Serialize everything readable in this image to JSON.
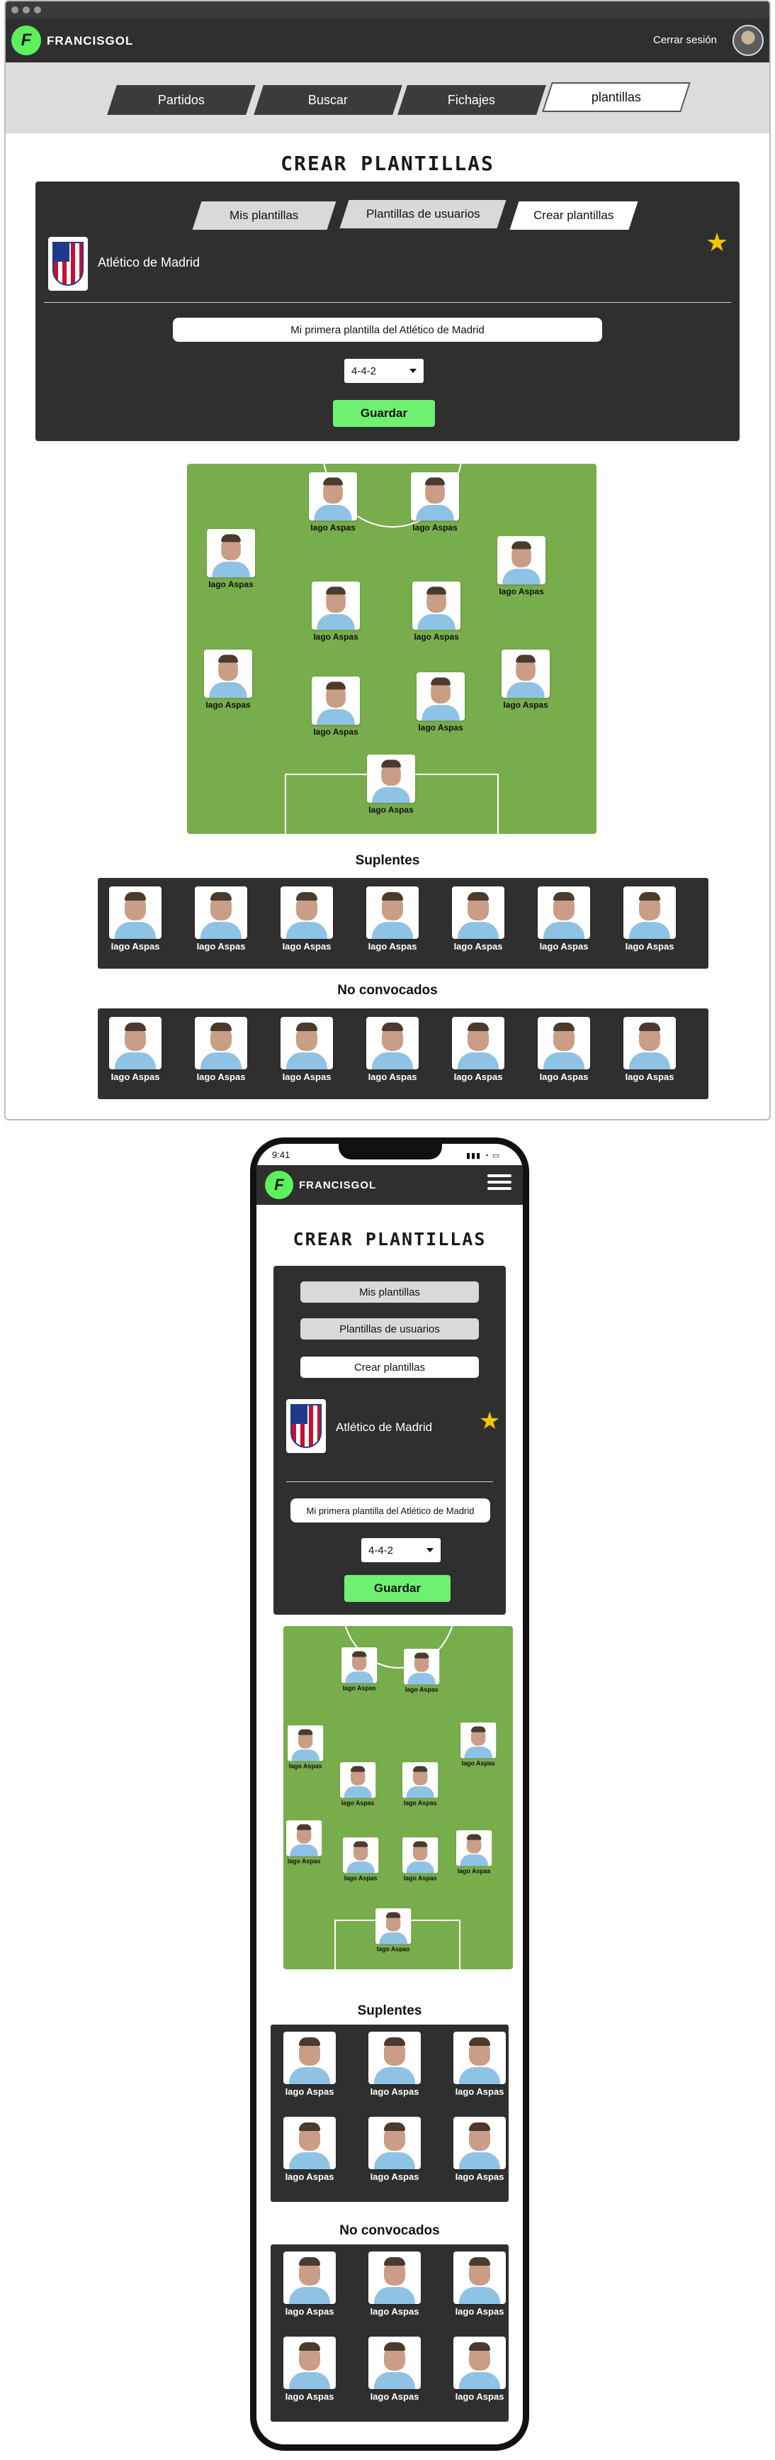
{
  "app": {
    "brand": "FRANCISGOL",
    "logout_label": "Cerrar sesión",
    "accent_color": "#6ff070",
    "dark_color": "#2f2f2f"
  },
  "nav": {
    "tabs": [
      {
        "label": "Partidos"
      },
      {
        "label": "Buscar"
      },
      {
        "label": "Fichajes"
      },
      {
        "label": "plantillas"
      }
    ],
    "active": "plantillas"
  },
  "page": {
    "title": "CREAR PLANTILLAS"
  },
  "subtabs": [
    {
      "label": "Mis plantillas"
    },
    {
      "label": "Plantillas de usuarios"
    },
    {
      "label": "Crear plantillas"
    }
  ],
  "team": {
    "name": "Atlético de Madrid"
  },
  "form": {
    "squad_name": "Mi primera plantilla del Atlético de Madrid",
    "formation": "4-4-2",
    "save_label": "Guardar"
  },
  "player": {
    "name": "Iago Aspas"
  },
  "sections": {
    "subs_title": "Suplentes",
    "excluded_title": "No convocados"
  },
  "phone": {
    "time": "9:41"
  }
}
